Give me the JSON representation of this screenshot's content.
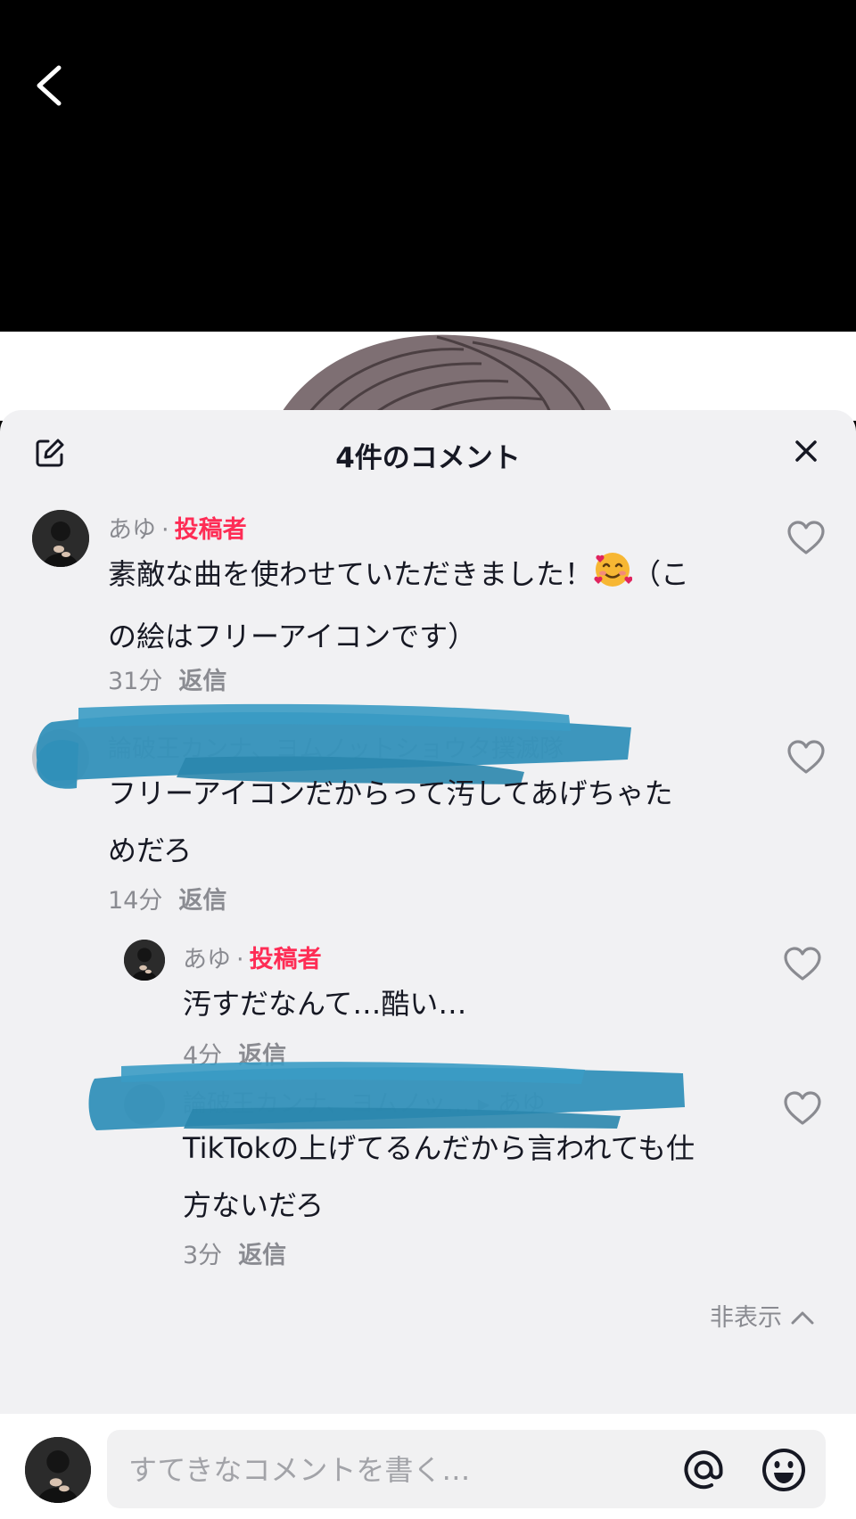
{
  "header": {
    "title": "4件のコメント"
  },
  "comments": [
    {
      "author": "あゆ",
      "separator": "·",
      "tag": "投稿者",
      "text_before": "素敵な曲を使わせていただきました！",
      "emoji": "smiling-face-with-hearts",
      "text_after": "（こ",
      "text_line2": "の絵はフリーアイコンです）",
      "time": "31分",
      "reply": "返信"
    },
    {
      "author": "論破王カンナ、ヨムノットショウタ撲滅隊",
      "text_line1": "フリーアイコンだからって汚してあげちゃた",
      "text_line2": "めだろ",
      "time": "14分",
      "reply": "返信",
      "replies": [
        {
          "author": "あゆ",
          "separator": "·",
          "tag": "投稿者",
          "text_line1": "汚すだなんて…酷い…",
          "time": "4分",
          "reply": "返信"
        },
        {
          "author": "論破王カンナ、ヨムノッ… ▸ あゆ",
          "text_line1": "TikTokの上げてるんだから言われても仕",
          "text_line2": "方ないだろ",
          "time": "3分",
          "reply": "返信"
        }
      ]
    }
  ],
  "hide_label": "非表示",
  "input": {
    "placeholder": "すてきなコメントを書く…"
  },
  "colors": {
    "accent": "#fe2c55",
    "scribble": "#2f8fb8",
    "sheet_bg": "#f1f1f3"
  }
}
